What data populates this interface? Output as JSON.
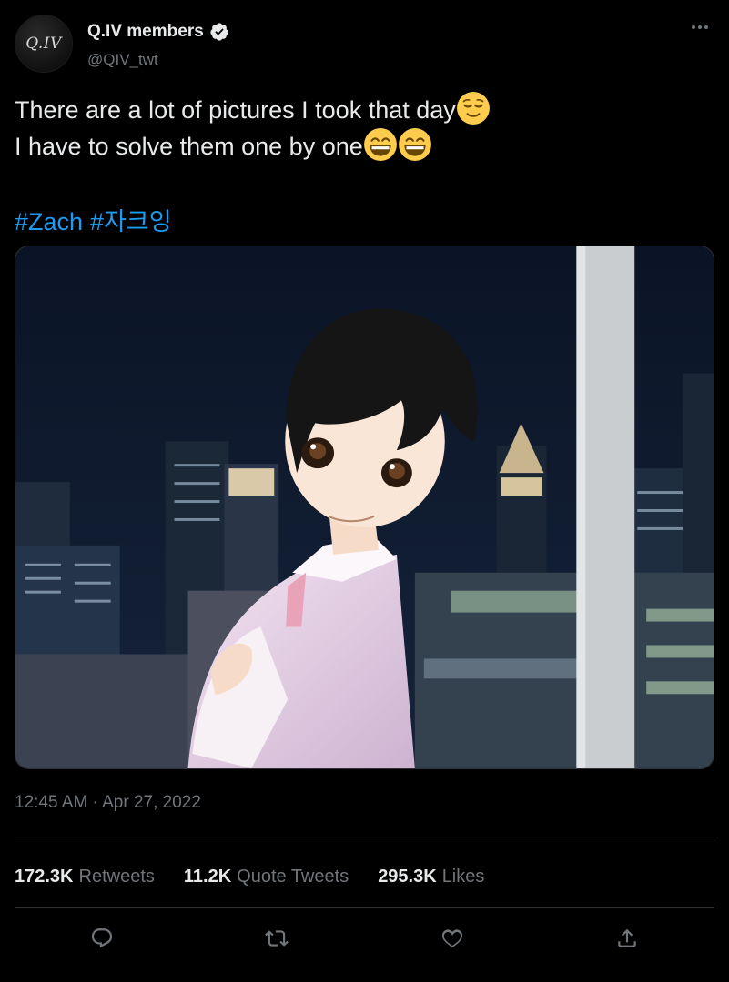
{
  "author": {
    "display_name": "Q.IV members",
    "handle": "@QIV_twt",
    "avatar_text": "Q.IV",
    "verified_icon": "verified-badge-icon"
  },
  "more_icon": "more-options-icon",
  "tweet": {
    "line1": "There are a lot of pictures I took that day",
    "line1_emoji": "relieved-face-emoji",
    "line2": "I have to solve them one by one",
    "line2_emojis": [
      "grinning-face-emoji",
      "grinning-face-emoji"
    ],
    "hashtags": [
      "#Zach",
      "#자크잉"
    ]
  },
  "media": {
    "description_icon": "anime-character-night-city-image"
  },
  "timestamp": {
    "time": "12:45 AM",
    "separator": " · ",
    "date": "Apr 27, 2022"
  },
  "stats": {
    "retweets_count": "172.3K",
    "retweets_label": "Retweets",
    "quotes_count": "11.2K",
    "quotes_label": "Quote Tweets",
    "likes_count": "295.3K",
    "likes_label": "Likes"
  },
  "actions": [
    "reply-icon",
    "retweet-icon",
    "like-icon",
    "share-icon"
  ],
  "colors": {
    "background": "#000000",
    "text_primary": "#e7e9ea",
    "text_secondary": "#71767b",
    "link": "#1d9bf0",
    "divider": "#2f3336"
  }
}
